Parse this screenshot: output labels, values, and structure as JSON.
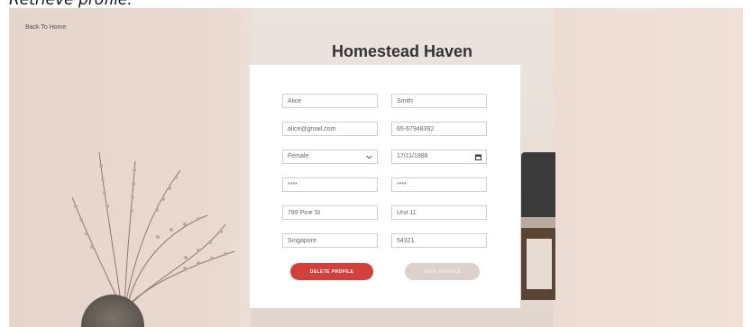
{
  "caption": "Retrieve profile:",
  "nav": {
    "back_label": "Back To Home"
  },
  "brand": {
    "title": "Homestead Haven"
  },
  "form": {
    "first_name": "Alice",
    "last_name": "Smith",
    "email": "alice@gmail.com",
    "phone": "65-67948392",
    "gender": "Female",
    "dob": "17/11/1988",
    "password": "****",
    "confirm_password": "****",
    "address": "789 Pine St",
    "unit": "Unit 11",
    "city": "Singapore",
    "postal_code": "54321"
  },
  "actions": {
    "delete_label": "DELETE PROFILE",
    "save_label": "SAVE PROFILE"
  },
  "icons": {
    "dropdown": "chevron-down-icon",
    "calendar": "calendar-icon"
  },
  "colors": {
    "delete": "#d2403c",
    "save_disabled": "#dcd1cb",
    "card": "#ffffff"
  }
}
